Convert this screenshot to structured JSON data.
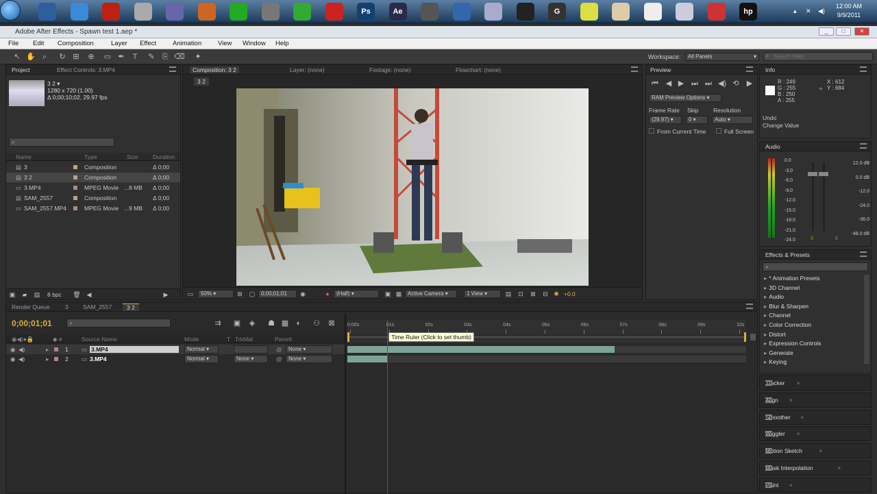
{
  "taskbar": {
    "icons": [
      {
        "name": "chrome-download-icon",
        "label": "",
        "color": "#2f5e9e"
      },
      {
        "name": "skype-icon",
        "label": "",
        "color": "#3a8ad6"
      },
      {
        "name": "media-player-icon",
        "label": "",
        "color": "#b21"
      },
      {
        "name": "dvd-icon",
        "label": "",
        "color": "#aaa"
      },
      {
        "name": "network-icon",
        "label": "",
        "color": "#66a"
      },
      {
        "name": "game-icon",
        "label": "",
        "color": "#c62"
      },
      {
        "name": "xilisoft-icon",
        "label": "",
        "color": "#2a2"
      },
      {
        "name": "tool-icon",
        "label": "",
        "color": "#777"
      },
      {
        "name": "utorrent-icon",
        "label": "",
        "color": "#3a3"
      },
      {
        "name": "app-icon",
        "label": "",
        "color": "#c22"
      },
      {
        "name": "photoshop-icon",
        "label": "Ps",
        "color": "#13406e"
      },
      {
        "name": "after-effects-icon",
        "label": "Ae",
        "color": "#2a2a4a"
      },
      {
        "name": "grid-app-icon",
        "label": "",
        "color": "#555"
      },
      {
        "name": "globe-icon",
        "label": "",
        "color": "#36a"
      },
      {
        "name": "save-icon",
        "label": "",
        "color": "#aac"
      },
      {
        "name": "terminal-icon",
        "label": "",
        "color": "#222"
      },
      {
        "name": "g-app-icon",
        "label": "G",
        "color": "#333"
      },
      {
        "name": "chrome-icon",
        "label": "",
        "color": "#dd4"
      },
      {
        "name": "folder-icon",
        "label": "",
        "color": "#dca"
      },
      {
        "name": "piano-icon",
        "label": "",
        "color": "#eee"
      },
      {
        "name": "window-icon",
        "label": "",
        "color": "#ccd"
      },
      {
        "name": "firefox-icon",
        "label": "",
        "color": "#c33"
      },
      {
        "name": "hp-icon",
        "label": "hp",
        "color": "#111"
      }
    ],
    "time": "12:00 AM",
    "date": "9/9/2011"
  },
  "window": {
    "title": "Adobe After Effects - Spawn test 1.aep *"
  },
  "menu": [
    "File",
    "Edit",
    "Composition",
    "Layer",
    "Effect",
    "Animation",
    "View",
    "Window",
    "Help"
  ],
  "workspace": {
    "label": "Workspace:",
    "value": "All Panels",
    "search_placeholder": "Search Help"
  },
  "project": {
    "tab_project": "Project",
    "tab_effect": "Effect Controls: 3.MP4",
    "selected_name": "3 2 ▾",
    "selected_res": "1280 x 720 (1.00)",
    "selected_dur": "Δ 0;00;10;02, 29.97 fps",
    "col_name": "Name",
    "col_type": "Type",
    "col_size": "Size",
    "col_dur": "Duration",
    "items": [
      {
        "name": "3",
        "type": "Composition",
        "size": "",
        "dur": "Δ 0;00",
        "color": "#b9a28a"
      },
      {
        "name": "3 2",
        "type": "Composition",
        "size": "",
        "dur": "Δ 0;00",
        "color": "#b9a28a"
      },
      {
        "name": "3.MP4",
        "type": "MPEG Movie",
        "size": "...8 MB",
        "dur": "Δ 0;00",
        "color": "#a88"
      },
      {
        "name": "SAM_2557",
        "type": "Composition",
        "size": "",
        "dur": "Δ 0;00",
        "color": "#b9a28a"
      },
      {
        "name": "SAM_2557.MP4",
        "type": "MPEG Movie",
        "size": "...9 MB",
        "dur": "Δ 0;00",
        "color": "#a88"
      }
    ],
    "bpc": "8 bpc"
  },
  "comp": {
    "tab_comp": "Composition: 3 2",
    "tab_layer": "Layer: (none)",
    "tab_footage": "Footage: (none)",
    "tab_flow": "Flowchart: (none)",
    "chip": "3 2",
    "zoom": "50%",
    "timecode": "0;00;01;01",
    "resolution": "(Half)",
    "camera": "Active Camera",
    "view": "1 View",
    "exposure": "+0.0"
  },
  "preview": {
    "title": "Preview",
    "ram": "RAM Preview Options",
    "fr_label": "Frame Rate",
    "skip_label": "Skip",
    "res_label": "Resolution",
    "fr_value": "(29.97)",
    "skip_value": "0",
    "res_value": "Auto",
    "from_current": "From Current Time",
    "full_screen": "Full Screen"
  },
  "info": {
    "title": "Info",
    "r": "R : 249",
    "g": "G : 255",
    "b": "B : 250",
    "a": "A : 255",
    "x": "X : 612",
    "y": "Y : 684",
    "undo": "Undo",
    "undo_action": "Change Value"
  },
  "audio": {
    "title": "Audio",
    "left_scale": [
      "0.0",
      "-3.0",
      "-6.0",
      "-9.0",
      "-12.0",
      "-15.0",
      "-18.0",
      "-21.0",
      "-24.0"
    ],
    "right_scale": [
      "12.0 dB",
      "0.0 dB",
      "-12.0",
      "-24.0",
      "-36.0",
      "-48.0 dB"
    ],
    "l_val": "0",
    "r_val": "0"
  },
  "effects": {
    "title": "Effects & Presets",
    "items": [
      "* Animation Presets",
      "3D Channel",
      "Audio",
      "Blur & Sharpen",
      "Channel",
      "Color Correction",
      "Distort",
      "Expression Controls",
      "Generate",
      "Keying"
    ]
  },
  "collapsed": [
    "Tracker",
    "Align",
    "Smoother",
    "Wiggler",
    "Motion Sketch",
    "Mask Interpolation",
    "Paint"
  ],
  "timeline": {
    "tab_render": "Render Queue",
    "tab_3": "3",
    "tab_sam": "SAM_2557",
    "tab_32": "3 2",
    "timecode": "0;00;01;01",
    "col_source": "Source Name",
    "col_mode": "Mode",
    "col_t": "T",
    "col_trkmat": "TrkMat",
    "col_parent": "Parent",
    "ruler": [
      "0:00s",
      "01s",
      "02s",
      "03s",
      "04s",
      "05s",
      "06s",
      "07s",
      "08s",
      "09s",
      "10s"
    ],
    "tooltip": "Time Ruler (Click to set thumb)",
    "playhead_fraction": 0.1,
    "layers": [
      {
        "num": "1",
        "name": "3.MP4",
        "mode": "Normal",
        "trkmat": "",
        "parent": "None",
        "end_fraction": 0.67
      },
      {
        "num": "2",
        "name": "3.MP4",
        "mode": "Normal",
        "trkmat": "None",
        "parent": "None",
        "end_fraction": 0.1
      }
    ]
  }
}
